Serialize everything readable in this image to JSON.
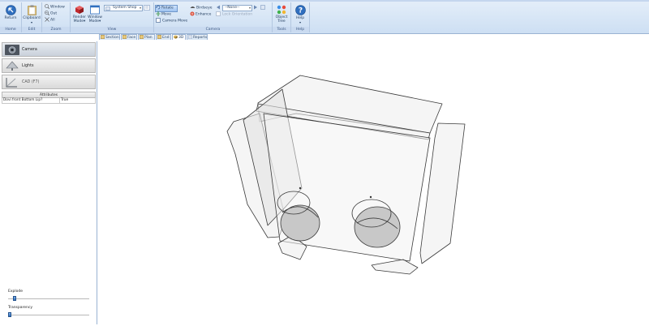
{
  "ribbon": {
    "groups": {
      "home": "Home",
      "edit": "Edit",
      "zoom": "Zoom",
      "view": "View",
      "camera": "Camera",
      "tools": "Tools",
      "help": "Help"
    },
    "return_label": "Return",
    "clipboard_label": "Clipboard",
    "zoom_window": "Window",
    "zoom_out": "Out",
    "zoom_all": "All",
    "render_mode_line1": "Render",
    "render_mode_line2": "Mode",
    "window_mode_line1": "Window",
    "window_mode_line2": "Mode",
    "view_combo_value": "System Shop",
    "rotate_label": "Rotate",
    "move_label": "Move",
    "camera_move_label": "Camera Move",
    "birdseye_label": "Birdseye",
    "enhance_label": "Enhance",
    "camera_combo_value": "--None--",
    "lock_orientation_label": "Lock Orientation",
    "object_tree_line1": "Object",
    "object_tree_line2": "Tree",
    "help_label": "Help"
  },
  "tabs": [
    {
      "label": "Section"
    },
    {
      "label": "Face"
    },
    {
      "label": "Plan"
    },
    {
      "label": "End"
    },
    {
      "label": "3D"
    },
    {
      "label": "Reports"
    }
  ],
  "sidebar": {
    "camera": "Camera",
    "lights": "Lights",
    "cad": "CAD (F7)",
    "attributes_header": "Attributes",
    "attribute_rows": [
      {
        "name": "Dovi front Bottom Lip?",
        "value": "True"
      }
    ],
    "explode_label": "Explode",
    "explode_value": 0.08,
    "transparency_label": "Transparency",
    "transparency_value": 0.02
  },
  "colors": {
    "ribbon_bg": "#d5e4f6",
    "accent_blue": "#2f6fbf",
    "panel_fill": "#e8e8e8",
    "hole_fill": "#c8c8c8"
  }
}
